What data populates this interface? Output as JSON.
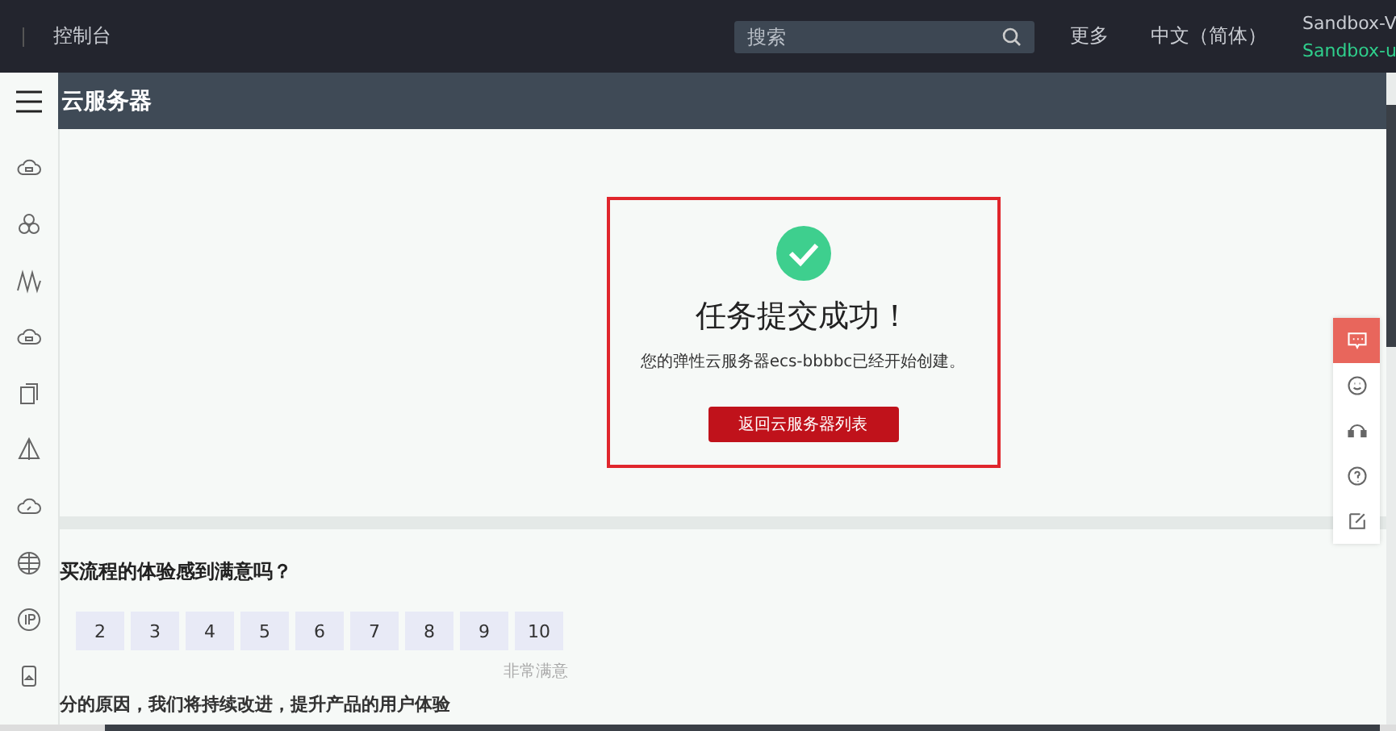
{
  "topbar": {
    "console": "控制台",
    "search": {
      "placeholder": "搜索"
    },
    "more": "更多",
    "language": "中文（简体）",
    "account": "Sandbox-V",
    "user": "Sandbox-u"
  },
  "header": {
    "title": "云服务器"
  },
  "sidebar": {
    "items": [
      {
        "kind": "cloud"
      },
      {
        "kind": "cluster"
      },
      {
        "kind": "wave"
      },
      {
        "kind": "cloud"
      },
      {
        "kind": "copy"
      },
      {
        "kind": "cone"
      },
      {
        "kind": "cloud-link"
      },
      {
        "kind": "globe"
      },
      {
        "kind": "ip"
      },
      {
        "kind": "phone"
      }
    ]
  },
  "result": {
    "title": "任务提交成功！",
    "message": "您的弹性云服务器ecs-bbbbc已经开始创建。",
    "button": "返回云服务器列表"
  },
  "survey": {
    "question": "买流程的体验感到满意吗？",
    "scale": [
      "2",
      "3",
      "4",
      "5",
      "6",
      "7",
      "8",
      "9",
      "10"
    ],
    "high_label": "非常满意",
    "followup": "分的原因，我们将持续改进，提升产品的用户体验"
  },
  "float_tools": [
    {
      "kind": "chat",
      "selected": true
    },
    {
      "kind": "smile",
      "selected": false
    },
    {
      "kind": "headset",
      "selected": false
    },
    {
      "kind": "help",
      "selected": false
    },
    {
      "kind": "edit",
      "selected": false
    }
  ]
}
